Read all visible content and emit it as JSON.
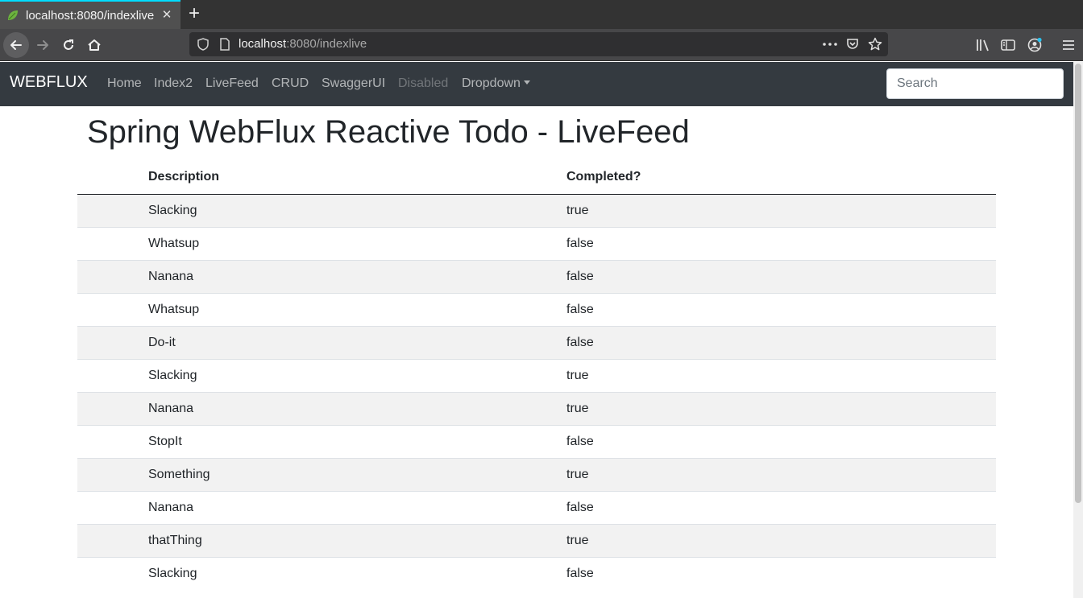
{
  "browser": {
    "tab_title": "localhost:8080/indexlive",
    "url_host": "localhost",
    "url_rest": ":8080/indexlive",
    "accent_color": "#00ddff"
  },
  "navbar": {
    "brand": "WEBFLUX",
    "links": [
      {
        "label": "Home"
      },
      {
        "label": "Index2"
      },
      {
        "label": "LiveFeed"
      },
      {
        "label": "CRUD"
      },
      {
        "label": "SwaggerUI"
      },
      {
        "label": "Disabled"
      },
      {
        "label": "Dropdown"
      }
    ],
    "search_placeholder": "Search",
    "background_color": "#343a40"
  },
  "page": {
    "title": "Spring WebFlux Reactive Todo - LiveFeed"
  },
  "table": {
    "columns": [
      "Description",
      "Completed?"
    ],
    "rows": [
      {
        "description": "Slacking",
        "completed": "true"
      },
      {
        "description": "Whatsup",
        "completed": "false"
      },
      {
        "description": "Nanana",
        "completed": "false"
      },
      {
        "description": "Whatsup",
        "completed": "false"
      },
      {
        "description": "Do-it",
        "completed": "false"
      },
      {
        "description": "Slacking",
        "completed": "true"
      },
      {
        "description": "Nanana",
        "completed": "true"
      },
      {
        "description": "StopIt",
        "completed": "false"
      },
      {
        "description": "Something",
        "completed": "true"
      },
      {
        "description": "Nanana",
        "completed": "false"
      },
      {
        "description": "thatThing",
        "completed": "true"
      },
      {
        "description": "Slacking",
        "completed": "false"
      }
    ]
  }
}
